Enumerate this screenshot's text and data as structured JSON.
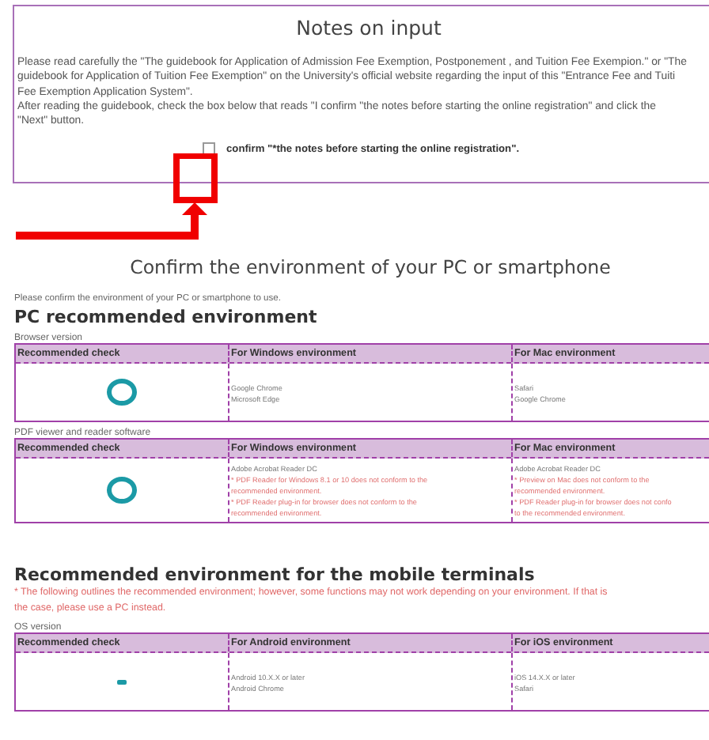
{
  "notes": {
    "title": "Notes on input",
    "paragraph_lines": [
      "Please read carefully the \"The guidebook for Application of Admission Fee Exemption, Postponement , and Tuition Fee Exempion.\" or \"The",
      "guidebook for Application of Tuition Fee Exemption\" on the University's official website regarding the input of this \"Entrance Fee and Tuiti",
      "Fee Exemption Application System\".",
      "After reading the guidebook, check the box below that reads \"I confirm \"the notes before starting the online registration\" and click the",
      "\"Next\" button."
    ],
    "confirm": {
      "label": "confirm \"*the notes before starting the online registration\".",
      "checked": false
    }
  },
  "environment": {
    "title": "Confirm the environment of your PC or smartphone",
    "intro": "Please confirm the environment of your PC or smartphone to use.",
    "sections": [
      {
        "heading": "PC recommended environment",
        "tables": [
          {
            "caption": "Browser version",
            "columns": [
              "Recommended check",
              "For Windows environment",
              "For Mac environment"
            ],
            "rows": [
              {
                "cells": [
                  {
                    "kind": "circle"
                  },
                  {
                    "kind": "lines",
                    "lines": [
                      {
                        "text": "Google Chrome",
                        "kind": "plain"
                      },
                      {
                        "text": "Microsoft Edge",
                        "kind": "plain"
                      }
                    ]
                  },
                  {
                    "kind": "lines",
                    "lines": [
                      {
                        "text": "Safari",
                        "kind": "plain"
                      },
                      {
                        "text": "Google Chrome",
                        "kind": "plain"
                      }
                    ]
                  }
                ]
              }
            ]
          },
          {
            "caption": "PDF viewer and reader software",
            "columns": [
              "Recommended check",
              "For Windows environment",
              "For Mac environment"
            ],
            "rows": [
              {
                "cells": [
                  {
                    "kind": "circle"
                  },
                  {
                    "kind": "lines",
                    "lines": [
                      {
                        "text": "Adobe Acrobat Reader DC",
                        "kind": "plain"
                      },
                      {
                        "text": "* PDF Reader for Windows 8.1 or 10 does not conform to the",
                        "kind": "warning"
                      },
                      {
                        "text": "recommended environment.",
                        "kind": "warning"
                      },
                      {
                        "text": "* PDF Reader plug-in for browser does not conform to the",
                        "kind": "warning"
                      },
                      {
                        "text": "recommended environment.",
                        "kind": "warning"
                      }
                    ]
                  },
                  {
                    "kind": "lines",
                    "lines": [
                      {
                        "text": "Adobe Acrobat Reader DC",
                        "kind": "plain"
                      },
                      {
                        "text": "* Preview on Mac does not conform to the",
                        "kind": "warning"
                      },
                      {
                        "text": "recommended environment.",
                        "kind": "warning"
                      },
                      {
                        "text": "* PDF Reader plug-in for browser does not confo",
                        "kind": "warning"
                      },
                      {
                        "text": "to the recommended environment.",
                        "kind": "warning"
                      }
                    ]
                  }
                ]
              }
            ]
          }
        ]
      },
      {
        "heading": "Recommended environment for the mobile terminals",
        "note_lines": [
          "* The following outlines the recommended environment; however, some functions may not work depending on your environment. If that is",
          "the case, please use a PC instead."
        ],
        "tables": [
          {
            "caption": "OS version",
            "columns": [
              "Recommended check",
              "For Android environment",
              "For iOS environment"
            ],
            "rows": [
              {
                "cells": [
                  {
                    "kind": "dash"
                  },
                  {
                    "kind": "lines",
                    "lines": [
                      {
                        "text": "Android 10.X.X or later",
                        "kind": "plain"
                      },
                      {
                        "text": "Android Chrome",
                        "kind": "plain"
                      }
                    ]
                  },
                  {
                    "kind": "lines",
                    "lines": [
                      {
                        "text": "iOS 14.X.X or later",
                        "kind": "plain"
                      },
                      {
                        "text": "Safari",
                        "kind": "plain"
                      }
                    ]
                  }
                ]
              }
            ]
          }
        ]
      }
    ]
  }
}
